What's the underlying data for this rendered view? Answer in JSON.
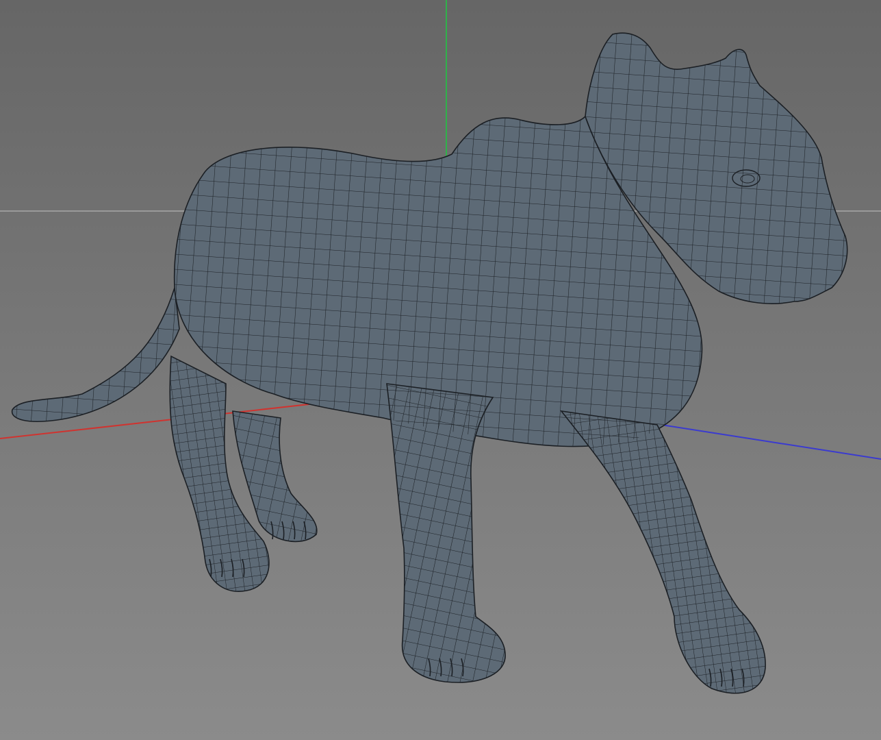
{
  "viewport": {
    "background_top": "#666666",
    "background_bottom": "#8b8b8b",
    "horizon_color": "#9a9a9a"
  },
  "axes": {
    "x_color": "#d0332f",
    "y_color": "#2fb24a",
    "z_color": "#3a3ad0"
  },
  "mesh": {
    "fill_color": "#5d6a76",
    "shadow_color": "#4a5560",
    "wire_color": "#1b1f24"
  }
}
